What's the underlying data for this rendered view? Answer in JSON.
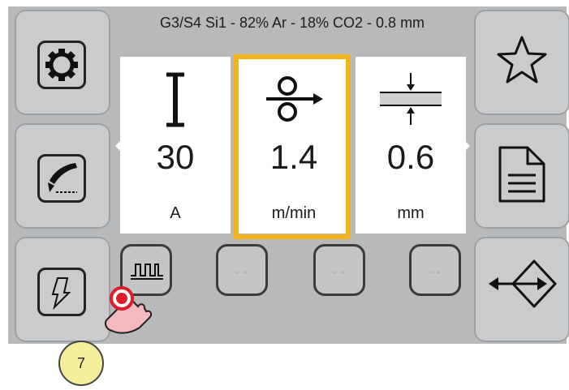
{
  "header": {
    "title": "G3/S4 Si1 - 82% Ar - 18% CO2 - 0.8 mm"
  },
  "left_menu": [
    {
      "name": "settings",
      "icon": "gear-icon"
    },
    {
      "name": "torch",
      "icon": "welding-torch-icon"
    },
    {
      "name": "trigger-mode",
      "icon": "trigger-icon"
    }
  ],
  "right_menu": [
    {
      "name": "favorites",
      "icon": "star-icon"
    },
    {
      "name": "jobs",
      "icon": "document-icon"
    },
    {
      "name": "exit",
      "icon": "exit-arrow-icon"
    }
  ],
  "params": [
    {
      "label": "current",
      "icon": "current-icon",
      "value": "30",
      "unit": "A"
    },
    {
      "label": "wire-speed",
      "icon": "wire-feed-icon",
      "value": "1.4",
      "unit": "m/min",
      "selected": true
    },
    {
      "label": "thickness",
      "icon": "thickness-icon",
      "value": "0.6",
      "unit": "mm"
    }
  ],
  "bottom_buttons": [
    {
      "name": "pulse",
      "icon": "pulse-wave-icon",
      "label": ""
    },
    {
      "name": "empty-1",
      "label": "- -"
    },
    {
      "name": "empty-2",
      "label": "- -"
    },
    {
      "name": "empty-3",
      "label": "- -"
    }
  ],
  "annotation": {
    "step": "7"
  },
  "colors": {
    "panel": "#b7b9bb",
    "selection": "#f5b21a",
    "touch": "#e11d2a"
  }
}
